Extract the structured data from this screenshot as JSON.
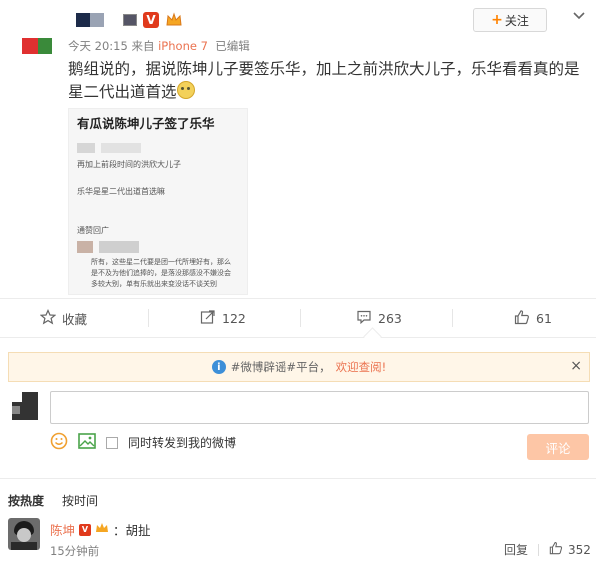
{
  "post": {
    "follow_label": "关注",
    "follow_plus": "+",
    "meta_time": "今天 20:15 来自 ",
    "meta_device": "iPhone 7",
    "meta_edited": "已编辑",
    "text": "鹅组说的，据说陈坤儿子要签乐华，加上之前洪欣大儿子，乐华看看真的是星二代出道首选"
  },
  "embedded_image": {
    "title": "有瓜说陈坤儿子签了乐华",
    "line1": "再加上前段时间的洪欣大儿子",
    "line2": "乐华是星二代出道首选嘛",
    "line3": "通赞回广",
    "reply1": "所有，这些星二代要是团一代所埋好有，那么",
    "reply2": "是不及为他们追捧的，是落没那感没不嫌没会",
    "reply3": "多较大别，单有乐就出来变没话不谈关别"
  },
  "actions": {
    "favorite": "收藏",
    "forward_count": "122",
    "comment_count": "263",
    "like_count": "61"
  },
  "notice": {
    "info_icon": "i",
    "text_main": "#微博辟谣#平台，",
    "text_link": "欢迎查阅!",
    "close": "×"
  },
  "compose": {
    "input_value": "",
    "repost_label": "同时转发到我的微博",
    "submit_label": "评论"
  },
  "sort": {
    "by_heat": "按热度",
    "by_time": "按时间"
  },
  "comment": {
    "name": "陈坤",
    "badge": "V",
    "text": "：胡扯",
    "time": "15分钟前",
    "reply_label": "回复",
    "like_count": "352"
  },
  "colors": {
    "accent_orange": "#eb7350",
    "brand_orange": "#ff8200",
    "submit_disabled": "#fdc6a6",
    "notice_bg": "#fff6e8"
  }
}
